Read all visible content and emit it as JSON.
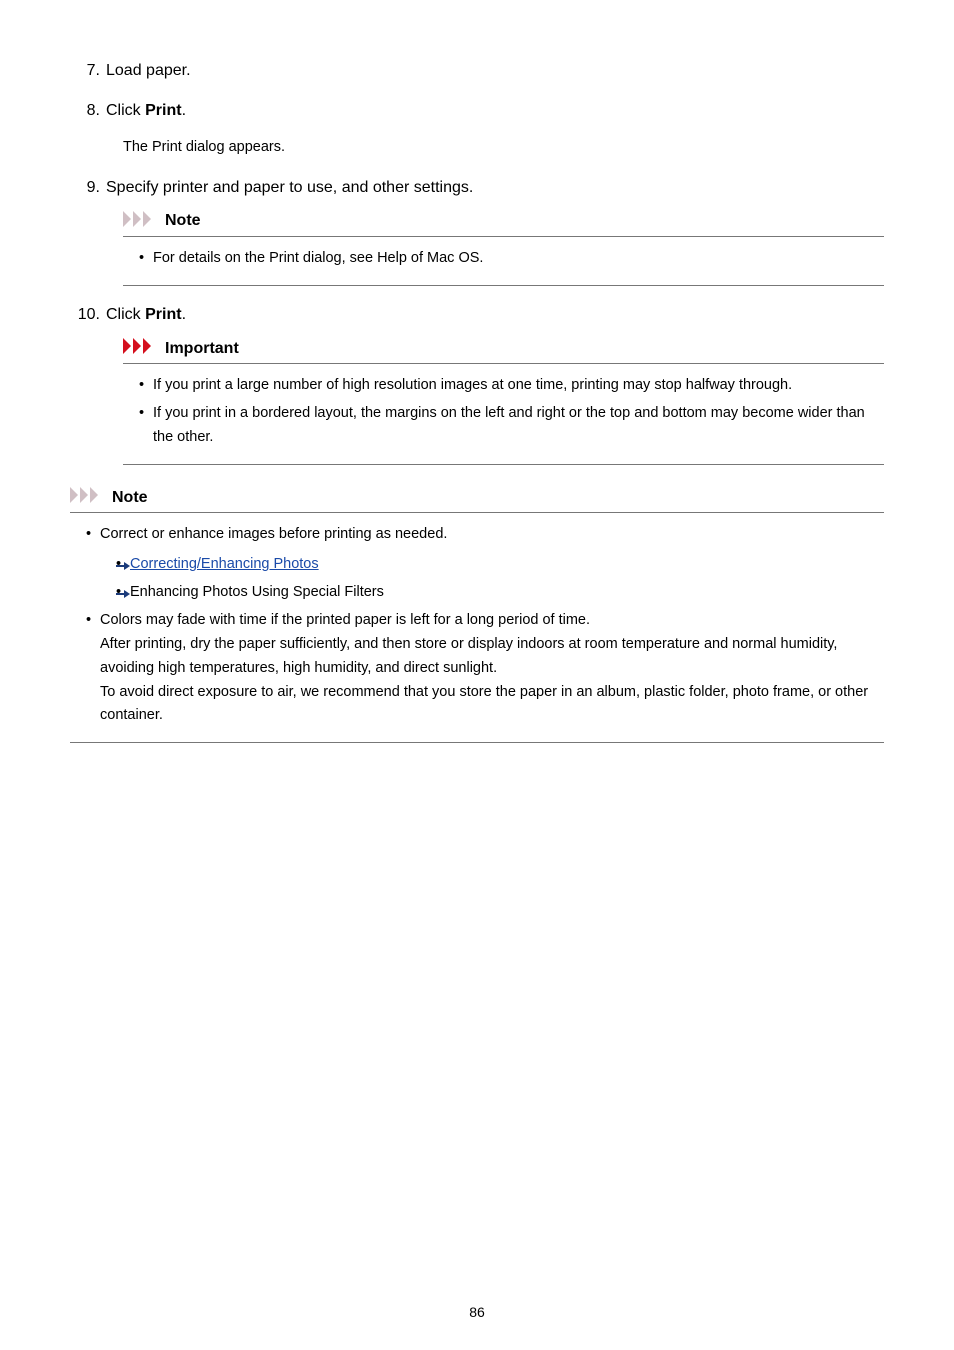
{
  "steps": {
    "s7": {
      "num": "7.",
      "text": "Load paper."
    },
    "s8": {
      "num": "8.",
      "text_pre": "Click ",
      "text_bold": "Print",
      "text_post": ".",
      "body": "The Print dialog appears."
    },
    "s9": {
      "num": "9.",
      "text": "Specify printer and paper to use, and other settings."
    },
    "s10": {
      "num": "10.",
      "text_pre": "Click ",
      "text_bold": "Print",
      "text_post": "."
    }
  },
  "note1": {
    "title": "Note",
    "item": "For details on the Print dialog, see Help of Mac OS."
  },
  "important": {
    "title": "Important",
    "item1": "If you print a large number of high resolution images at one time, printing may stop halfway through.",
    "item2": "If you print in a bordered layout, the margins on the left and right or the top and bottom may become wider than the other."
  },
  "note2": {
    "title": "Note",
    "item1": "Correct or enhance images before printing as needed.",
    "link1": "Correcting/Enhancing Photos",
    "link2": "Enhancing Photos Using Special Filters",
    "item2_l1": "Colors may fade with time if the printed paper is left for a long period of time.",
    "item2_l2": "After printing, dry the paper sufficiently, and then store or display indoors at room temperature and normal humidity, avoiding high temperatures, high humidity, and direct sunlight.",
    "item2_l3": "To avoid direct exposure to air, we recommend that you store the paper in an album, plastic folder, photo frame, or other container."
  },
  "pagenum": "86"
}
